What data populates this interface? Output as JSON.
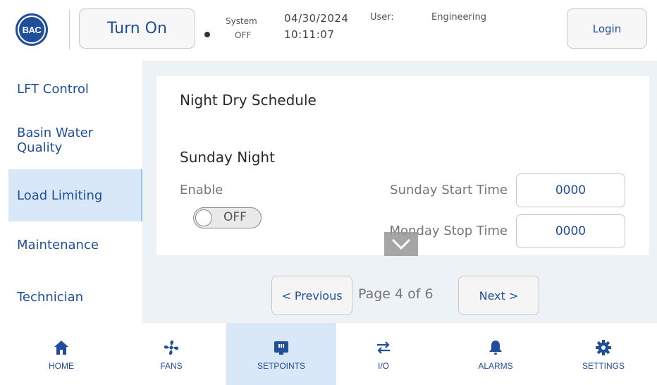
{
  "header": {
    "logo_text": "BAC",
    "turn_on_label": "Turn On",
    "system_label": "System",
    "system_value": "OFF",
    "date": "04/30/2024",
    "time": "10:11:07",
    "user_label": "User:",
    "user_value": "Engineering",
    "login_label": "Login"
  },
  "sidebar": {
    "items": [
      {
        "label": "LFT Control"
      },
      {
        "label": "Basin Water Quality"
      },
      {
        "label": "Load Limiting"
      },
      {
        "label": "Maintenance"
      },
      {
        "label": "Technician"
      }
    ]
  },
  "main": {
    "title": "Night Dry Schedule",
    "subtitle": "Sunday Night",
    "enable_label": "Enable",
    "toggle_text": "OFF",
    "start_label": "Sunday Start Time",
    "start_value": "0000",
    "stop_label": "Monday Stop Time",
    "stop_value": "0000",
    "previous_label": "< Previous",
    "page_text": "Page 4 of 6",
    "next_label": "Next >"
  },
  "bottom_nav": {
    "items": [
      {
        "label": "HOME",
        "icon": "home-icon"
      },
      {
        "label": "FANS",
        "icon": "fan-icon"
      },
      {
        "label": "SETPOINTS",
        "icon": "setpoints-icon"
      },
      {
        "label": "I/O",
        "icon": "io-arrows-icon"
      },
      {
        "label": "ALARMS",
        "icon": "bell-icon"
      },
      {
        "label": "SETTINGS",
        "icon": "gear-icon"
      }
    ]
  },
  "colors": {
    "accent": "#1f4e9a",
    "active_bg": "#d9e8f9",
    "content_bg": "#edf2f7"
  }
}
